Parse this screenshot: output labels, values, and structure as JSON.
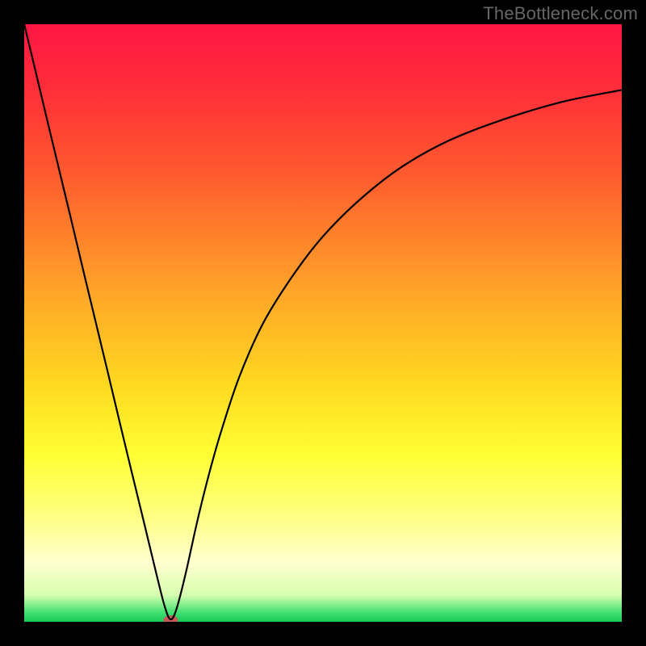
{
  "watermark": "TheBottleneck.com",
  "chart_data": {
    "type": "line",
    "title": "",
    "xlabel": "",
    "ylabel": "",
    "xlim": [
      0,
      100
    ],
    "ylim": [
      0,
      100
    ],
    "background_gradient": {
      "stops": [
        {
          "offset": 0.0,
          "color": "#ff1744"
        },
        {
          "offset": 0.1,
          "color": "#ff2b3a"
        },
        {
          "offset": 0.25,
          "color": "#ff5a2e"
        },
        {
          "offset": 0.45,
          "color": "#ffa628"
        },
        {
          "offset": 0.6,
          "color": "#ffd820"
        },
        {
          "offset": 0.72,
          "color": "#ffff33"
        },
        {
          "offset": 0.82,
          "color": "#ffff80"
        },
        {
          "offset": 0.9,
          "color": "#ffffcf"
        },
        {
          "offset": 0.955,
          "color": "#d8ffb0"
        },
        {
          "offset": 0.985,
          "color": "#3fe070"
        },
        {
          "offset": 1.0,
          "color": "#16c95a"
        }
      ]
    },
    "series": [
      {
        "name": "bottleneck-curve",
        "x": [
          0,
          2,
          4,
          6,
          8,
          10,
          12,
          14,
          16,
          18,
          20,
          22,
          23.5,
          24.5,
          25.5,
          27,
          29,
          31,
          33,
          36,
          40,
          45,
          50,
          56,
          63,
          71,
          80,
          90,
          100
        ],
        "y": [
          100,
          91.7,
          83.3,
          75,
          66.7,
          58.3,
          50,
          41.7,
          33.3,
          25,
          16.8,
          8.5,
          2.6,
          0.4,
          2.2,
          8,
          17,
          25,
          32,
          41,
          50,
          58,
          64.5,
          70.5,
          76,
          80.5,
          84,
          87,
          89
        ]
      }
    ],
    "marker": {
      "name": "optimal-point",
      "x": 24.5,
      "y": 0.0,
      "color": "#c85a5a",
      "rx": 9,
      "ry": 6
    }
  }
}
